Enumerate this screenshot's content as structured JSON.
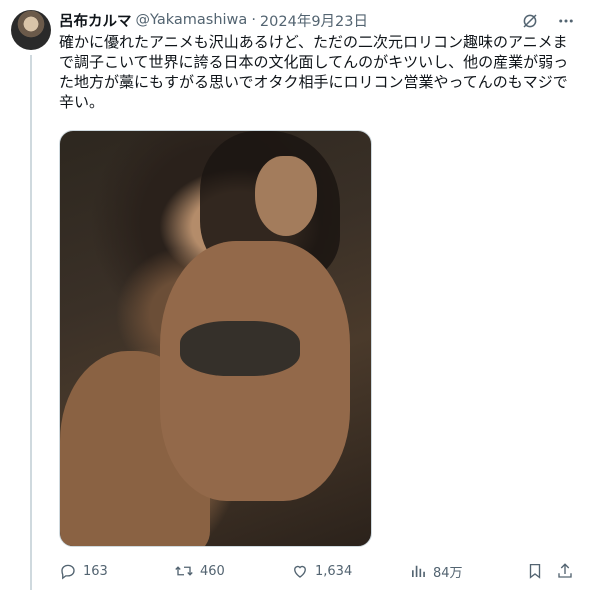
{
  "user": {
    "display_name": "呂布カルマ",
    "handle": "@Yakamashiwa",
    "separator": "·",
    "date": "2024年9月23日"
  },
  "header_icons": [
    "grok-icon",
    "more-icon"
  ],
  "tweet": {
    "text": "確かに優れたアニメも沢山あるけど、ただの二次元ロリコン趣味のアニメまで調子こいて世界に誇る日本の文化面してんのがキツいし、他の産業が弱った地方が藁にもすがる思いでオタク相手にロリコン営業やってんのもマジで辛い。"
  },
  "media": {
    "type": "photo"
  },
  "actions": {
    "reply_count": "163",
    "retweet_count": "460",
    "like_count": "1,634",
    "view_count": "84万"
  },
  "colors": {
    "text": "#0f1419",
    "muted": "#536471",
    "border": "#cfd9de"
  }
}
